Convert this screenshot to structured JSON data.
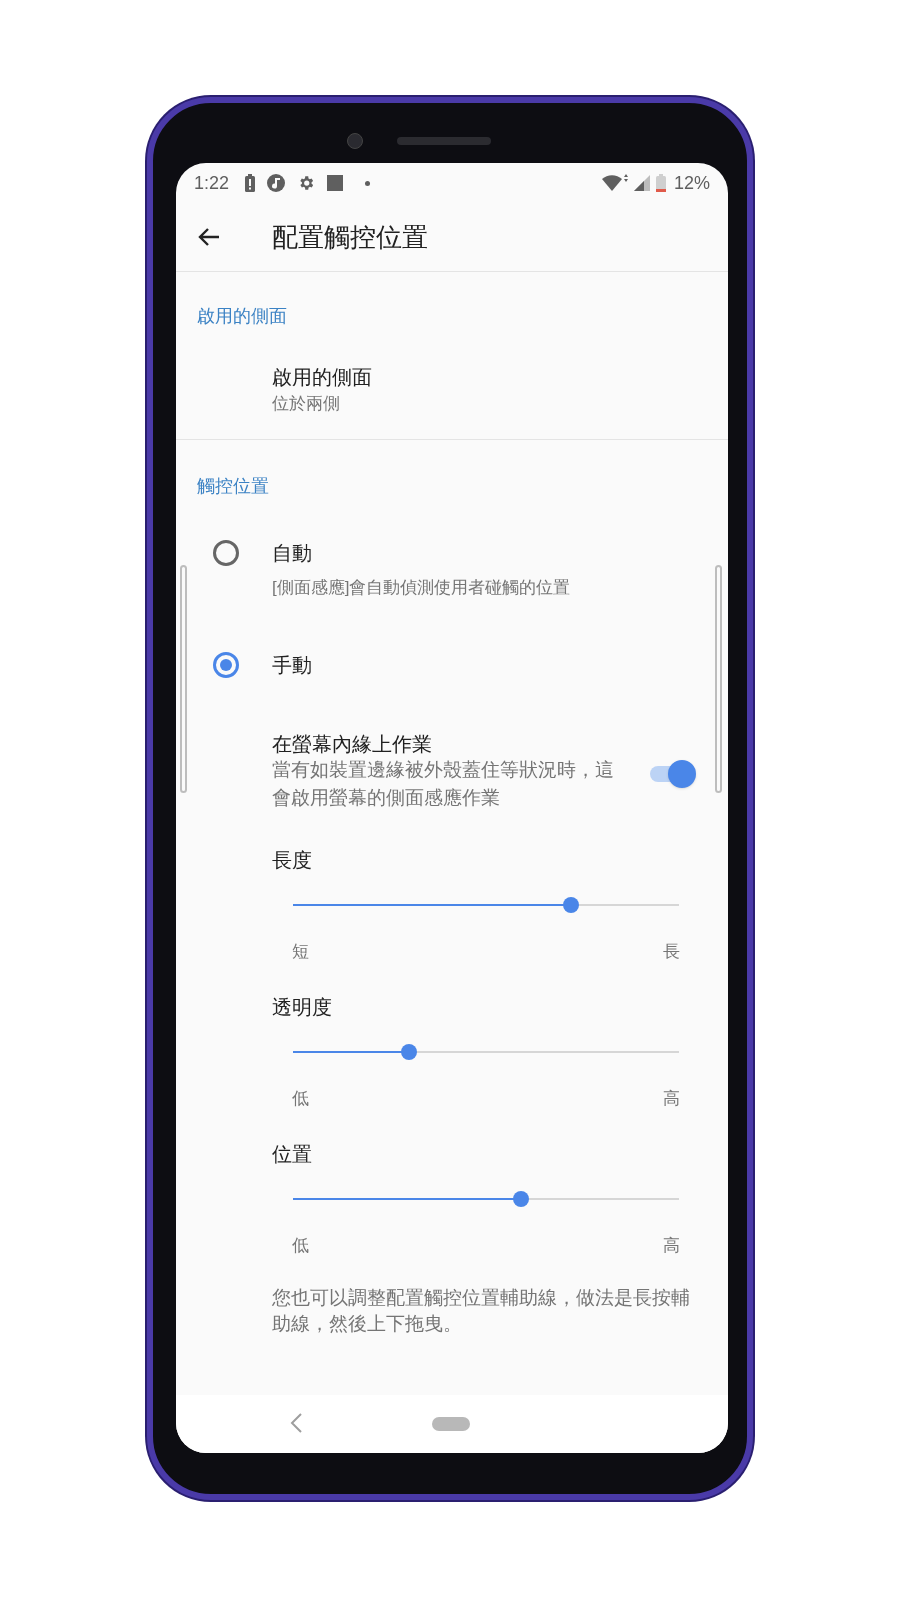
{
  "status_bar": {
    "time": "1:22",
    "battery": "12%"
  },
  "app_bar": {
    "title": "配置觸控位置"
  },
  "enabled_side": {
    "header": "啟用的側面",
    "title": "啟用的側面",
    "summary": "位於兩側"
  },
  "touch_position": {
    "header": "觸控位置",
    "options": [
      {
        "label": "自動",
        "description": "[側面感應]會自動偵測使用者碰觸的位置",
        "selected": false
      },
      {
        "label": "手動",
        "selected": true
      }
    ]
  },
  "inner_edge": {
    "title": "在螢幕內緣上作業",
    "description": "當有如裝置邊緣被外殼蓋住等狀況時，這會啟用螢幕的側面感應作業",
    "on": true
  },
  "sliders": [
    {
      "label": "長度",
      "level": 0.72,
      "min_label": "短",
      "max_label": "長"
    },
    {
      "label": "透明度",
      "level": 0.3,
      "min_label": "低",
      "max_label": "高"
    },
    {
      "label": "位置",
      "level": 0.59,
      "min_label": "低",
      "max_label": "高"
    }
  ],
  "note": "您也可以調整配置觸控位置輔助線，做法是長按輔助線，然後上下拖曳。"
}
